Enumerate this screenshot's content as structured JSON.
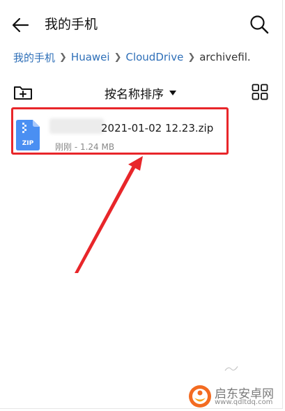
{
  "header": {
    "title": "我的手机",
    "back_icon": "back-arrow-icon",
    "search_icon": "search-icon"
  },
  "breadcrumb": {
    "items": [
      "我的手机",
      "Huawei",
      "CloudDrive",
      "archivefil..."
    ]
  },
  "toolbar": {
    "new_folder_icon": "new-folder-icon",
    "sort_label": "按名称排序",
    "view_toggle_icon": "grid-view-icon"
  },
  "files": [
    {
      "name_visible": "2021-01-02 12.23.zip",
      "type_badge": "ZIP",
      "modified": "刚刚",
      "size": "1.24 MB",
      "meta": "刚刚 - 1.24 MB"
    }
  ],
  "colors": {
    "accent_blue": "#2e6fb8",
    "zip_icon": "#4a8ff2",
    "highlight_red": "#e8262a"
  },
  "watermark": {
    "title": "启东安卓网",
    "url": "www.qdltdq.com"
  }
}
